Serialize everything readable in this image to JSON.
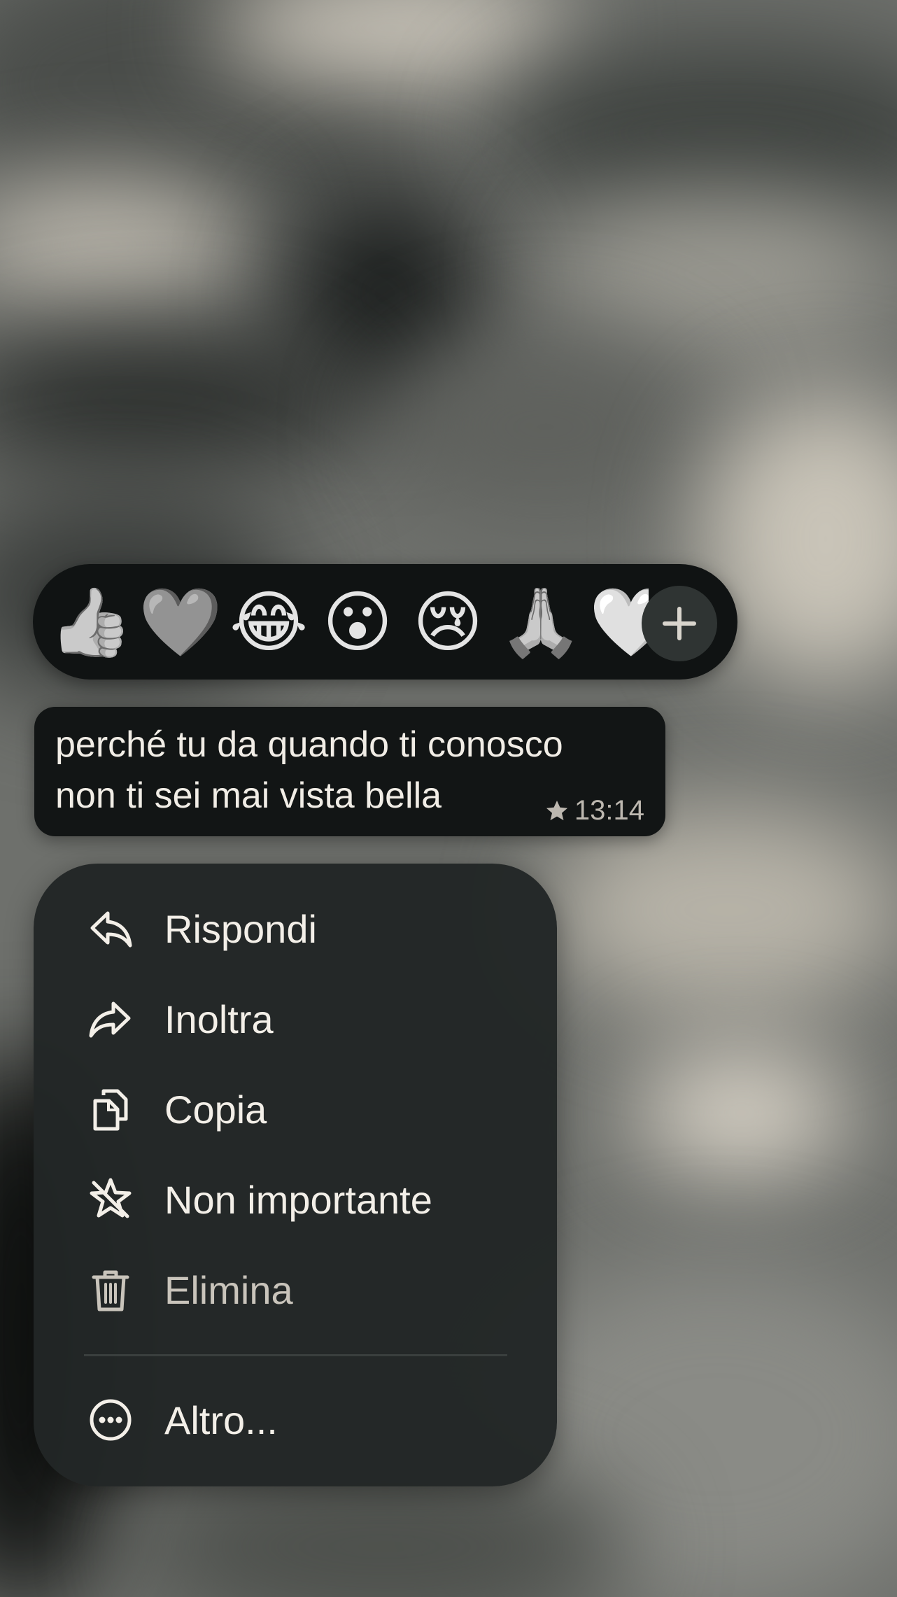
{
  "reactions": {
    "emojis": [
      {
        "char": "👍",
        "icon": "thumbs-up"
      },
      {
        "char": "🩶",
        "icon": "grey-heart"
      },
      {
        "char": "😂",
        "icon": "tears-of-joy"
      },
      {
        "char": "😮",
        "icon": "surprised-face"
      },
      {
        "char": "😢",
        "icon": "crying-face"
      },
      {
        "char": "🙏",
        "icon": "folded-hands"
      },
      {
        "char": "🤍",
        "icon": "white-heart"
      }
    ],
    "more_icon": "plus-icon"
  },
  "message": {
    "text_line1": "perché tu da quando ti conosco",
    "text_line2": "non ti sei mai vista bella",
    "time": "13:14",
    "starred_icon": "star-icon"
  },
  "menu": {
    "items": [
      {
        "label": "Rispondi",
        "icon": "reply-icon"
      },
      {
        "label": "Inoltra",
        "icon": "forward-icon"
      },
      {
        "label": "Copia",
        "icon": "copy-icon"
      },
      {
        "label": "Non importante",
        "icon": "unstar-icon"
      },
      {
        "label": "Elimina",
        "icon": "trash-icon"
      },
      {
        "label": "Altro...",
        "icon": "more-icon"
      }
    ]
  },
  "colors": {
    "panel": "#101313",
    "menu": "#222626",
    "text": "#f1ede6",
    "muted_text": "#c9c4bb"
  }
}
